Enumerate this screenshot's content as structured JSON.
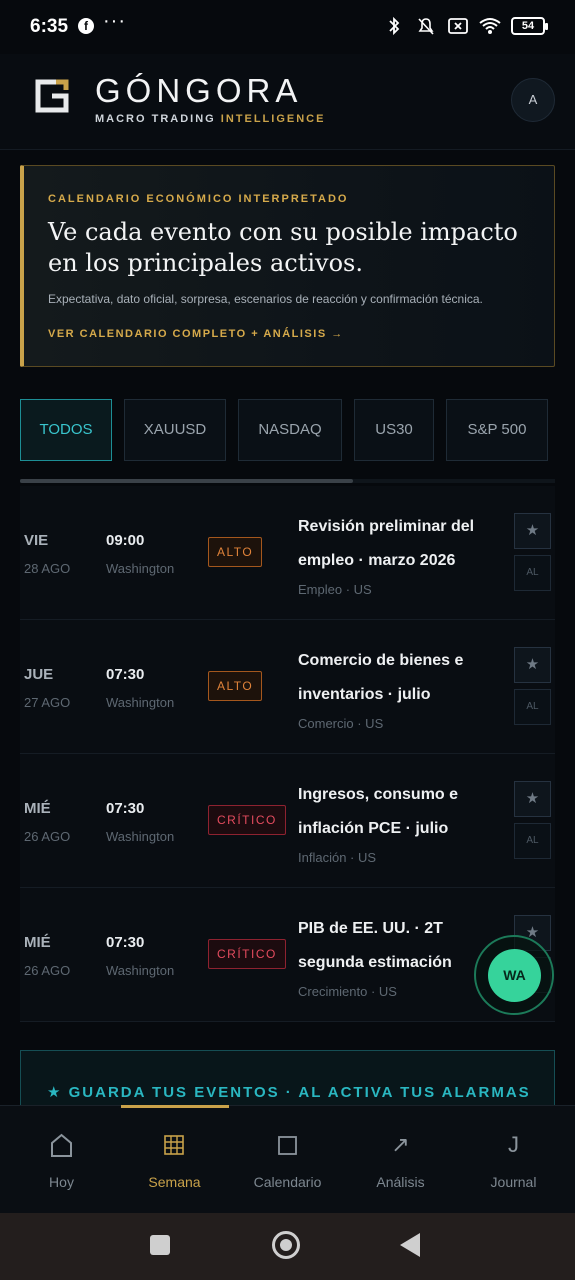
{
  "status_bar": {
    "time": "6:35",
    "app_icon": "f",
    "more": "···",
    "battery": "54"
  },
  "header": {
    "brand": "GÓNGORA",
    "subtitle_part1": "MACRO TRADING ",
    "subtitle_part2": "INTELLIGENCE",
    "avatar": "A"
  },
  "hero": {
    "kicker": "CALENDARIO ECONÓMICO INTERPRETADO",
    "title": "Ve cada evento con su posible impacto en los principales activos.",
    "description": "Expectativa, dato oficial, sorpresa, escenarios de reacción y confirmación técnica.",
    "link": "VER CALENDARIO COMPLETO + ANÁLISIS →"
  },
  "filters": [
    "TODOS",
    "XAUUSD",
    "NASDAQ",
    "US30",
    "S&P 500"
  ],
  "events": [
    {
      "day": "VIE",
      "date": "28 AGO",
      "time": "09:00",
      "location": "Washington",
      "impact": "ALTO",
      "title": "Revisión preliminar del empleo · marzo 2026",
      "category": "Empleo · US",
      "star": "★",
      "alarm": "AL"
    },
    {
      "day": "JUE",
      "date": "27 AGO",
      "time": "07:30",
      "location": "Washington",
      "impact": "ALTO",
      "title": "Comercio de bienes e inventarios · julio",
      "category": "Comercio · US",
      "star": "★",
      "alarm": "AL"
    },
    {
      "day": "MIÉ",
      "date": "26 AGO",
      "time": "07:30",
      "location": "Washington",
      "impact": "CRÍTICO",
      "title": "Ingresos, consumo e inflación PCE · julio",
      "category": "Inflación · US",
      "star": "★",
      "alarm": "AL"
    },
    {
      "day": "MIÉ",
      "date": "26 AGO",
      "time": "07:30",
      "location": "Washington",
      "impact": "CRÍTICO",
      "title": "PIB de EE. UU. · 2T segunda estimación",
      "category": "Crecimiento · US",
      "star": "★",
      "alarm": "AL"
    }
  ],
  "promo": {
    "text": "★ GUARDA TUS EVENTOS · AL ACTIVA TUS ALARMAS"
  },
  "fab": {
    "label": "WA"
  },
  "nav": [
    {
      "label": "Hoy",
      "icon": "home-icon"
    },
    {
      "label": "Semana",
      "icon": "grid-icon"
    },
    {
      "label": "Calendario",
      "icon": "square-icon"
    },
    {
      "label": "Análisis",
      "icon": "arrow-icon"
    },
    {
      "label": "Journal",
      "icon": "journal-icon"
    }
  ],
  "nav_icons": {
    "arrow": "↗",
    "journal": "J"
  },
  "colors": {
    "gold": "#c9a24a",
    "teal": "#39c5cd",
    "alto": "#e0833a",
    "critico": "#e34b5e",
    "whatsapp": "#36d39b"
  }
}
